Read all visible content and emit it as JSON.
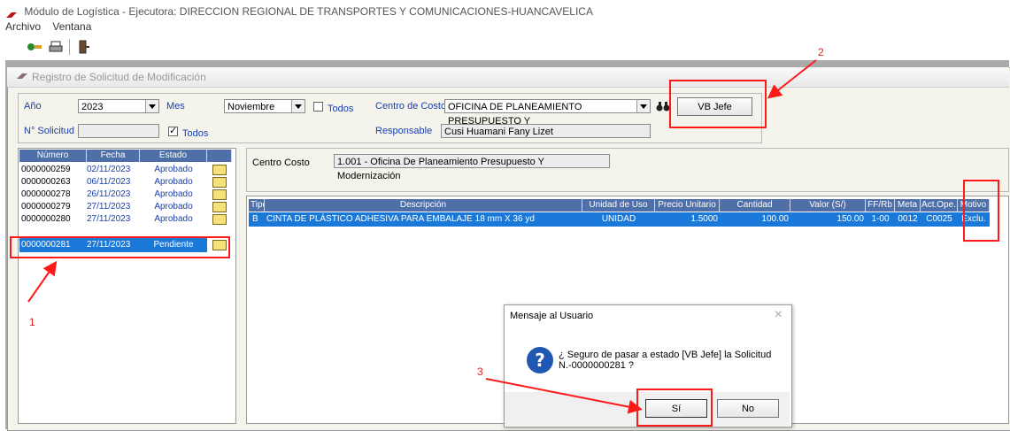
{
  "app": {
    "title": "Módulo de Logística - Ejecutora: DIRECCION REGIONAL DE TRANSPORTES Y COMUNICACIONES-HUANCAVELICA"
  },
  "menu": [
    "Archivo",
    "Ventana"
  ],
  "window": {
    "title": "Registro de Solicitud de Modificación"
  },
  "form": {
    "anio_label": "Año",
    "anio_value": "2023",
    "mes_label": "Mes",
    "mes_value": "Noviembre",
    "todos_label": "Todos",
    "centro_label": "Centro de Costo",
    "centro_value": "OFICINA DE PLANEAMIENTO PRESUPUESTO Y",
    "vb_jefe_label": "VB Jefe",
    "nsolicitud_label": "N° Solicitud",
    "nsolicitud_value": "",
    "todos2_label": "Todos",
    "responsable_label": "Responsable",
    "responsable_value": "Cusi Huamani Fany Lizet"
  },
  "solicitudes": {
    "headers": [
      "Número",
      "Fecha",
      "Estado"
    ],
    "rows": [
      {
        "numero": "0000000259",
        "fecha": "02/11/2023",
        "estado": "Aprobado"
      },
      {
        "numero": "0000000263",
        "fecha": "06/11/2023",
        "estado": "Aprobado"
      },
      {
        "numero": "0000000278",
        "fecha": "26/11/2023",
        "estado": "Aprobado"
      },
      {
        "numero": "0000000279",
        "fecha": "27/11/2023",
        "estado": "Aprobado"
      },
      {
        "numero": "0000000280",
        "fecha": "27/11/2023",
        "estado": "Aprobado"
      },
      {
        "numero": "0000000281",
        "fecha": "27/11/2023",
        "estado": "Pendiente"
      }
    ],
    "selected_index": 5
  },
  "detalle": {
    "centro_costo_label": "Centro Costo",
    "centro_costo_value": "1.001 - Oficina De Planeamiento Presupuesto Y Modernización",
    "headers": [
      "Tipo",
      "Descripción",
      "Unidad de Uso",
      "Precio Unitario",
      "Cantidad",
      "Valor (S/)",
      "FF/Rb",
      "Meta",
      "Act.Ope.",
      "Motivo"
    ],
    "rows": [
      {
        "tipo": "B",
        "descripcion": "CINTA DE PLÁSTICO ADHESIVA PARA EMBALAJE 18 mm X 36 yd",
        "unidad": "UNIDAD",
        "precio": "1.5000",
        "cantidad": "100.00",
        "valor": "150.00",
        "ffrb": "1-00",
        "meta": "0012",
        "actope": "C0025",
        "motivo": "Exclu."
      }
    ]
  },
  "dialog": {
    "title": "Mensaje al Usuario",
    "close": "×",
    "message_line1": "¿ Seguro de pasar a estado [VB Jefe] la Solicitud",
    "message_line2": "N.-0000000281 ?",
    "yes_label": "Sí",
    "no_label": "No"
  },
  "annotations": {
    "a1": "1",
    "a2": "2",
    "a3": "3"
  },
  "colors": {
    "header": "#4f6fa8",
    "selection": "#1a78d8",
    "link": "#1a3ea8",
    "annotation": "#ff1a1a"
  }
}
